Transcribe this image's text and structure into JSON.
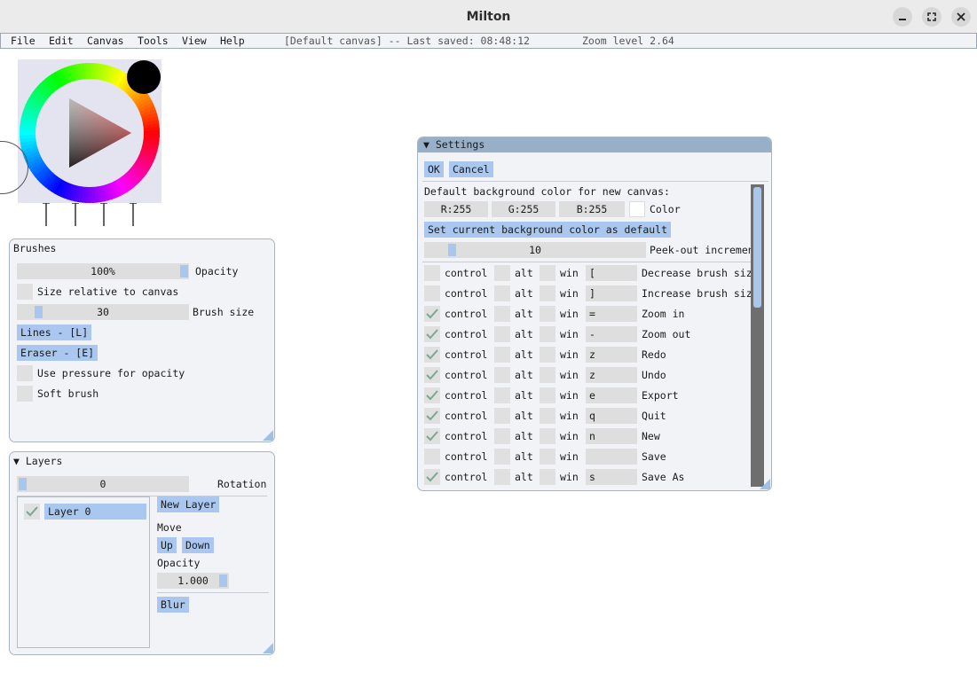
{
  "window": {
    "title": "Milton",
    "buttons": [
      "minimize",
      "maximize",
      "close"
    ]
  },
  "menubar": {
    "items": [
      "File",
      "Edit",
      "Canvas",
      "Tools",
      "View",
      "Help"
    ],
    "status": "[Default canvas] -- Last saved: 08:48:12",
    "zoom": "Zoom level 2.64"
  },
  "colors": {
    "accent": "#a9c7ef",
    "panel_bg": "#f1f3f6",
    "title_bar": "#97b0c8",
    "current_color": "#000000"
  },
  "brushes": {
    "title": "Brushes",
    "opacity_value": "100%",
    "opacity_fraction": 1.0,
    "opacity_label": "Opacity",
    "size_relative_label": "Size relative to canvas",
    "size_relative_checked": false,
    "brush_size_value": "30",
    "brush_size_label": "Brush size",
    "lines_button": "Lines - [L]",
    "eraser_button": "Eraser - [E]",
    "pressure_label": "Use pressure for opacity",
    "pressure_checked": false,
    "soft_label": "Soft brush",
    "soft_checked": false
  },
  "layers": {
    "title": "Layers",
    "rotation_value": "0",
    "rotation_label": "Rotation",
    "items": [
      {
        "name": "Layer 0",
        "visible": true
      }
    ],
    "new_layer_button": "New Layer",
    "move_label": "Move",
    "up_button": "Up",
    "down_button": "Down",
    "opacity_label": "Opacity",
    "opacity_value": "1.000",
    "blur_button": "Blur"
  },
  "settings": {
    "title": "Settings",
    "ok_button": "OK",
    "cancel_button": "Cancel",
    "bg_color_label": "Default background color for new canvas:",
    "r_value": "R:255",
    "g_value": "G:255",
    "b_value": "B:255",
    "color_label": "Color",
    "swatch_color": "#ffffff",
    "set_default_button": "Set current background color as default",
    "peek_value": "10",
    "peek_label": "Peek-out increment",
    "bindings": [
      {
        "control": false,
        "alt": false,
        "win": false,
        "key": "[",
        "action": "Decrease brush size"
      },
      {
        "control": false,
        "alt": false,
        "win": false,
        "key": "]",
        "action": "Increase brush size"
      },
      {
        "control": true,
        "alt": false,
        "win": false,
        "key": "=",
        "action": "Zoom in"
      },
      {
        "control": true,
        "alt": false,
        "win": false,
        "key": "-",
        "action": "Zoom out"
      },
      {
        "control": true,
        "alt": false,
        "win": false,
        "key": "z",
        "action": "Redo"
      },
      {
        "control": true,
        "alt": false,
        "win": false,
        "key": "z",
        "action": "Undo"
      },
      {
        "control": true,
        "alt": false,
        "win": false,
        "key": "e",
        "action": "Export"
      },
      {
        "control": true,
        "alt": false,
        "win": false,
        "key": "q",
        "action": "Quit"
      },
      {
        "control": true,
        "alt": false,
        "win": false,
        "key": "n",
        "action": "New"
      },
      {
        "control": false,
        "alt": false,
        "win": false,
        "key": "",
        "action": "Save"
      },
      {
        "control": true,
        "alt": false,
        "win": false,
        "key": "s",
        "action": "Save As"
      }
    ],
    "modifier_labels": {
      "control": "control",
      "alt": "alt",
      "win": "win"
    }
  }
}
